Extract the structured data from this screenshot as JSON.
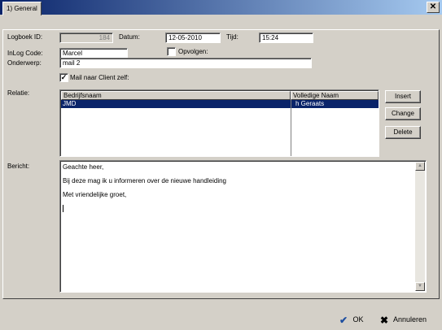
{
  "window": {
    "close_glyph": "✕"
  },
  "tabs": [
    {
      "label": "1) General",
      "active": true
    }
  ],
  "form": {
    "logboek_label": "Logboek ID:",
    "logboek_value": "184",
    "datum_label": "Datum:",
    "datum_value": "12-05-2010",
    "tijd_label": "Tijd:",
    "tijd_value": "15:24",
    "inlog_label": "InLog Code:",
    "inlog_value": "Marcel",
    "opvolgen_label": "Opvolgen:",
    "opvolgen_checked": false,
    "onderwerp_label": "Onderwerp:",
    "onderwerp_value": "mail 2",
    "mail_label": "Mail naar Client zelf:",
    "mail_check_glyph": "✓",
    "relatie_label": "Relatie:",
    "bericht_label": "Bericht:"
  },
  "relatie_table": {
    "columns": [
      "Bedrijfsnaam",
      "Volledige Naam"
    ],
    "rows": [
      {
        "bedrijfsnaam": "JMD",
        "volledige_naam": "h Geraats",
        "selected": true
      }
    ]
  },
  "relatie_buttons": {
    "insert": "Insert",
    "change": "Change",
    "delete": "Delete"
  },
  "bericht": {
    "lines": [
      "Geachte heer,",
      "Bij deze mag ik u informeren over de nieuwe handleiding",
      "Met vriendelijke groet,"
    ]
  },
  "footer": {
    "ok": "OK",
    "annuleren": "Annuleren"
  },
  "colors": {
    "selection": "#0a246a",
    "face": "#d4d0c8",
    "ok_icon": "#1e4fa0"
  }
}
